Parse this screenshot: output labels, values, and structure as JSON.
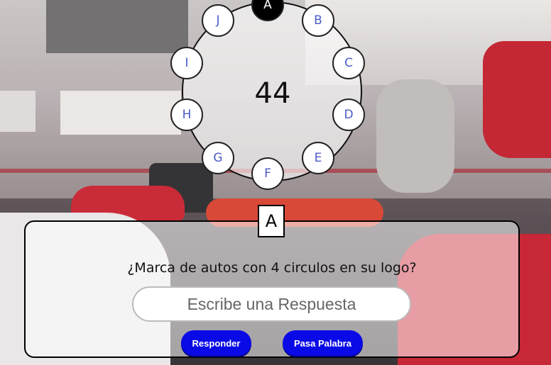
{
  "game": {
    "timer": "44",
    "current_letter": "A",
    "letters": [
      {
        "label": "A",
        "state": "active"
      },
      {
        "label": "B",
        "state": "pending"
      },
      {
        "label": "C",
        "state": "pending"
      },
      {
        "label": "D",
        "state": "pending"
      },
      {
        "label": "E",
        "state": "pending"
      },
      {
        "label": "F",
        "state": "pending"
      },
      {
        "label": "G",
        "state": "pending"
      },
      {
        "label": "H",
        "state": "pending"
      },
      {
        "label": "I",
        "state": "pending"
      },
      {
        "label": "J",
        "state": "pending"
      }
    ]
  },
  "question": {
    "text": "¿Marca de autos con 4 circulos en su logo?"
  },
  "answer": {
    "placeholder": "Escribe una Respuesta",
    "value": ""
  },
  "buttons": {
    "respond_label": "Responder",
    "pass_label": "Pasa Palabra"
  },
  "colors": {
    "letter_text": "#4a5bc7",
    "button_bg": "#0a0ae6",
    "active_letter_bg": "#000000"
  }
}
